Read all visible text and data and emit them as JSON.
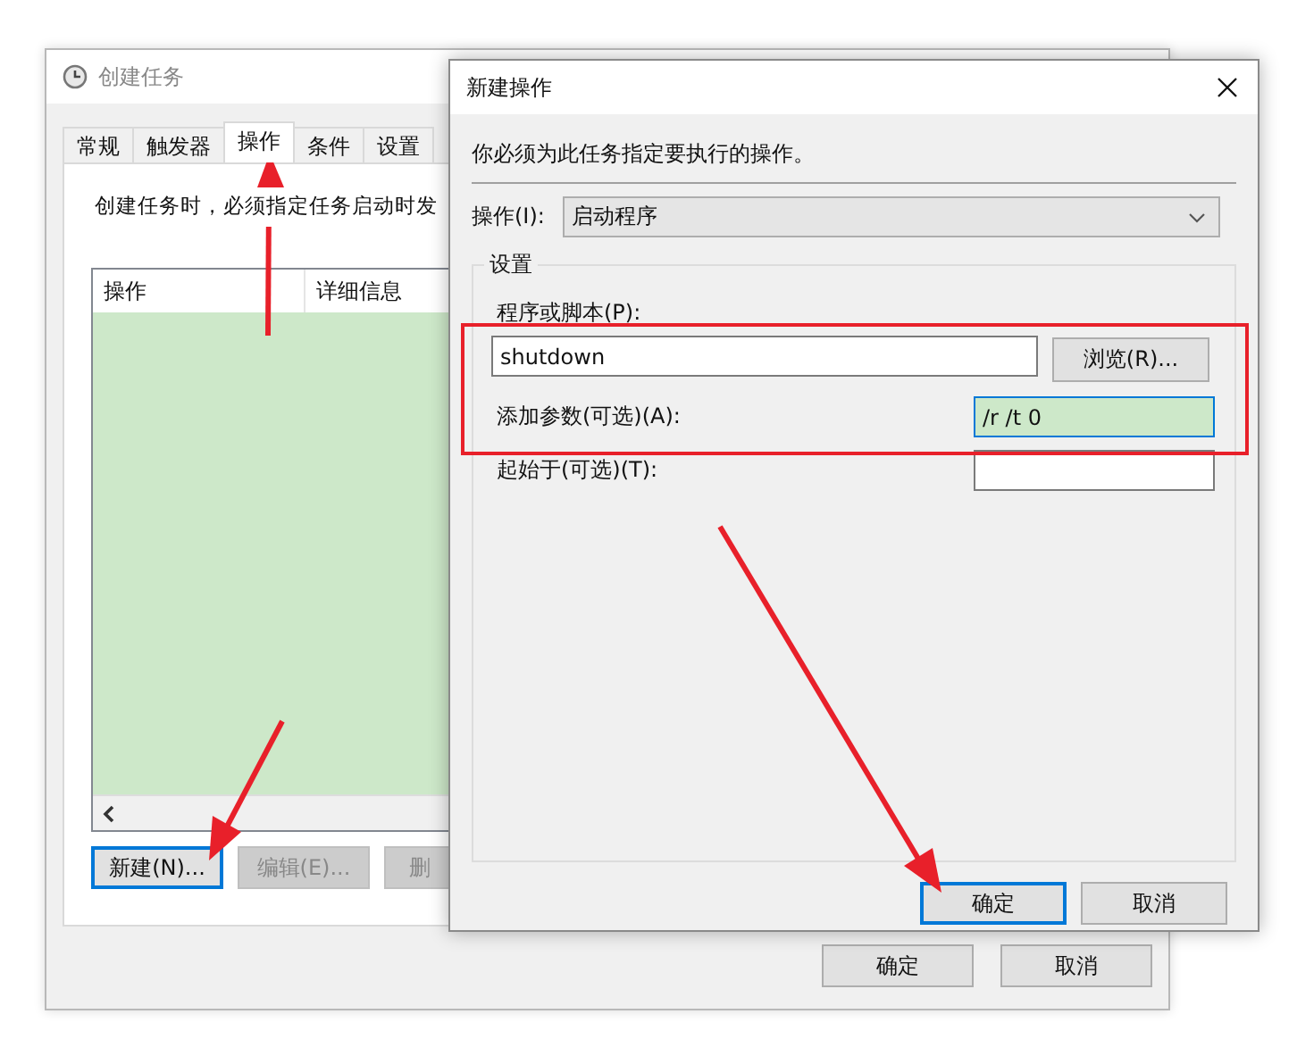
{
  "task_window": {
    "title": "创建任务",
    "tabs": [
      {
        "label": "常规",
        "selected": false
      },
      {
        "label": "触发器",
        "selected": false
      },
      {
        "label": "操作",
        "selected": true
      },
      {
        "label": "条件",
        "selected": false
      },
      {
        "label": "设置",
        "selected": false
      }
    ],
    "description": "创建任务时，必须指定任务启动时发",
    "list": {
      "columns": [
        "操作",
        "详细信息"
      ]
    },
    "buttons": [
      {
        "label": "新建(N)...",
        "disabled": false,
        "focused": true
      },
      {
        "label": "编辑(E)...",
        "disabled": true,
        "focused": false
      },
      {
        "label": "删",
        "disabled": true,
        "focused": false
      }
    ],
    "footer_buttons": [
      {
        "label": "确定"
      },
      {
        "label": "取消"
      }
    ]
  },
  "action_dialog": {
    "title": "新建操作",
    "description": "你必须为此任务指定要执行的操作。",
    "action": {
      "label": "操作(I):",
      "value": "启动程序"
    },
    "group_title": "设置",
    "program": {
      "label": "程序或脚本(P):",
      "value": "shutdown",
      "focused": false
    },
    "browse_button": "浏览(R)...",
    "fields": [
      {
        "label": "添加参数(可选)(A):",
        "value": "/r /t 0",
        "focused": true
      },
      {
        "label": "起始于(可选)(T):",
        "focused": false
      }
    ],
    "buttons": [
      {
        "label": "确定",
        "focused": true
      },
      {
        "label": "取消",
        "focused": false
      }
    ]
  }
}
